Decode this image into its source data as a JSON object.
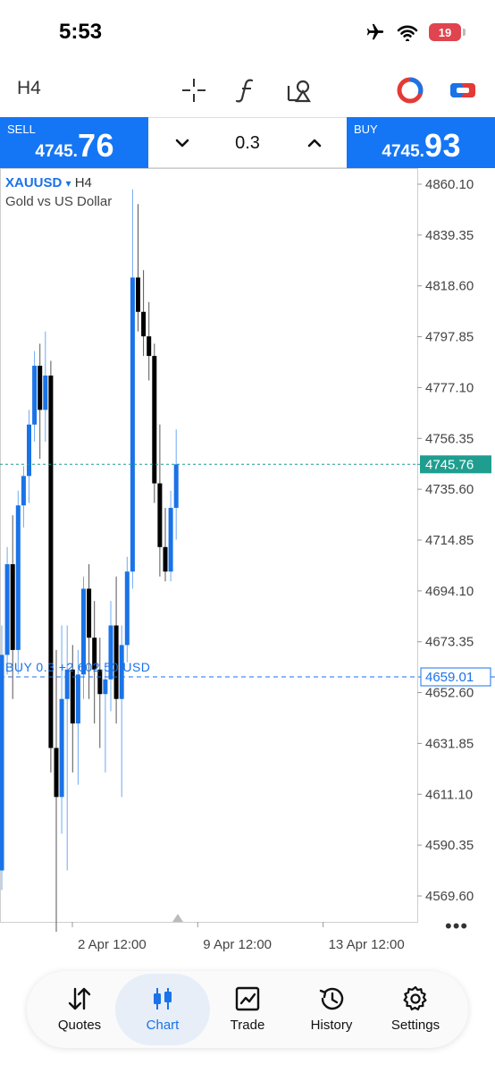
{
  "status_bar": {
    "time": "5:53",
    "battery_level": "19"
  },
  "toolbar": {
    "timeframe": "H4",
    "icons": [
      "crosshair-icon",
      "function-icon",
      "objects-icon",
      "account-icon",
      "trading-icon"
    ]
  },
  "trade": {
    "sell_label": "SELL",
    "sell_price_small": "4745.",
    "sell_price_big": "76",
    "quantity": "0.3",
    "buy_label": "BUY",
    "buy_price_small": "4745.",
    "buy_price_big": "93"
  },
  "chart": {
    "symbol": "XAUUSD",
    "dropdown_glyph": "▾",
    "timeframe": "H4",
    "description": "Gold vs US Dollar",
    "position_label": "BUY 0.3 +2 602.50 USD",
    "more_glyph": "•••",
    "colors": {
      "bull": "#1a73e8",
      "bear": "#000000",
      "bid_line": "#1f9e8f",
      "position_line": "#1a73e8"
    }
  },
  "chart_data": {
    "type": "candlestick",
    "title": "",
    "xlabel": "",
    "ylabel": "",
    "ylim": [
      4550,
      4865
    ],
    "y_ticks": [
      "4860.10",
      "4839.35",
      "4818.60",
      "4797.85",
      "4777.10",
      "4756.35",
      "4735.60",
      "4714.85",
      "4694.10",
      "4673.35",
      "4652.60",
      "4631.85",
      "4611.10",
      "4590.35",
      "4569.60"
    ],
    "x_ticks": [
      {
        "label": "2 Apr 12:00",
        "index": 10
      },
      {
        "label": "9 Apr 12:00",
        "index": 33
      },
      {
        "label": "13 Apr 12:00",
        "index": 56
      }
    ],
    "bid_price": 4745.76,
    "bid_price_label": "4745.76",
    "position_price": 4659.01,
    "position_price_label": "4659.01",
    "candles": [
      {
        "o": 4580,
        "h": 4680,
        "l": 4572,
        "c": 4668
      },
      {
        "o": 4668,
        "h": 4712,
        "l": 4660,
        "c": 4705
      },
      {
        "o": 4705,
        "h": 4725,
        "l": 4650,
        "c": 4670
      },
      {
        "o": 4670,
        "h": 4735,
        "l": 4660,
        "c": 4729
      },
      {
        "o": 4729,
        "h": 4745,
        "l": 4720,
        "c": 4741
      },
      {
        "o": 4741,
        "h": 4768,
        "l": 4730,
        "c": 4762
      },
      {
        "o": 4762,
        "h": 4792,
        "l": 4755,
        "c": 4786
      },
      {
        "o": 4786,
        "h": 4795,
        "l": 4748,
        "c": 4768
      },
      {
        "o": 4768,
        "h": 4800,
        "l": 4755,
        "c": 4782
      },
      {
        "o": 4782,
        "h": 4788,
        "l": 4620,
        "c": 4630
      },
      {
        "o": 4630,
        "h": 4670,
        "l": 4555,
        "c": 4610
      },
      {
        "o": 4610,
        "h": 4680,
        "l": 4595,
        "c": 4650
      },
      {
        "o": 4650,
        "h": 4680,
        "l": 4580,
        "c": 4662
      },
      {
        "o": 4662,
        "h": 4672,
        "l": 4620,
        "c": 4640
      },
      {
        "o": 4640,
        "h": 4670,
        "l": 4615,
        "c": 4660
      },
      {
        "o": 4660,
        "h": 4700,
        "l": 4650,
        "c": 4695
      },
      {
        "o": 4695,
        "h": 4705,
        "l": 4650,
        "c": 4675
      },
      {
        "o": 4675,
        "h": 4690,
        "l": 4640,
        "c": 4662
      },
      {
        "o": 4662,
        "h": 4675,
        "l": 4630,
        "c": 4652
      },
      {
        "o": 4652,
        "h": 4665,
        "l": 4620,
        "c": 4658
      },
      {
        "o": 4658,
        "h": 4690,
        "l": 4645,
        "c": 4680
      },
      {
        "o": 4680,
        "h": 4700,
        "l": 4640,
        "c": 4650
      },
      {
        "o": 4650,
        "h": 4680,
        "l": 4610,
        "c": 4672
      },
      {
        "o": 4672,
        "h": 4708,
        "l": 4665,
        "c": 4702
      },
      {
        "o": 4702,
        "h": 4858,
        "l": 4695,
        "c": 4822
      },
      {
        "o": 4822,
        "h": 4852,
        "l": 4800,
        "c": 4808
      },
      {
        "o": 4808,
        "h": 4825,
        "l": 4790,
        "c": 4798
      },
      {
        "o": 4798,
        "h": 4812,
        "l": 4780,
        "c": 4790
      },
      {
        "o": 4790,
        "h": 4795,
        "l": 4730,
        "c": 4738
      },
      {
        "o": 4738,
        "h": 4762,
        "l": 4700,
        "c": 4712
      },
      {
        "o": 4712,
        "h": 4728,
        "l": 4698,
        "c": 4702
      },
      {
        "o": 4702,
        "h": 4735,
        "l": 4698,
        "c": 4728
      },
      {
        "o": 4728,
        "h": 4760,
        "l": 4715,
        "c": 4745.76
      }
    ]
  },
  "nav": {
    "items": [
      {
        "label": "Quotes",
        "icon": "quotes-arrows-icon"
      },
      {
        "label": "Chart",
        "icon": "candles-icon"
      },
      {
        "label": "Trade",
        "icon": "trade-chart-icon"
      },
      {
        "label": "History",
        "icon": "history-clock-icon"
      },
      {
        "label": "Settings",
        "icon": "settings-gear-icon"
      }
    ],
    "active": "Chart"
  }
}
